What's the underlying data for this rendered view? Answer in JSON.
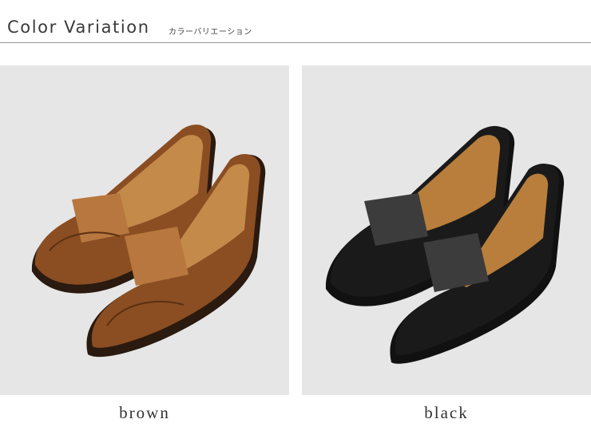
{
  "header": {
    "title": "Color Variation",
    "subtitle": "カラーバリエーション"
  },
  "variants": [
    {
      "label": "brown",
      "colors": {
        "upper": "#8a4e22",
        "upper_light": "#b8773e",
        "lining": "#c48a4a",
        "sole": "#2a1a10"
      }
    },
    {
      "label": "black",
      "colors": {
        "upper": "#1a1a1a",
        "upper_light": "#3c3c3c",
        "lining": "#b97e3c",
        "sole": "#111111"
      }
    }
  ],
  "background": "#e6e6e6"
}
